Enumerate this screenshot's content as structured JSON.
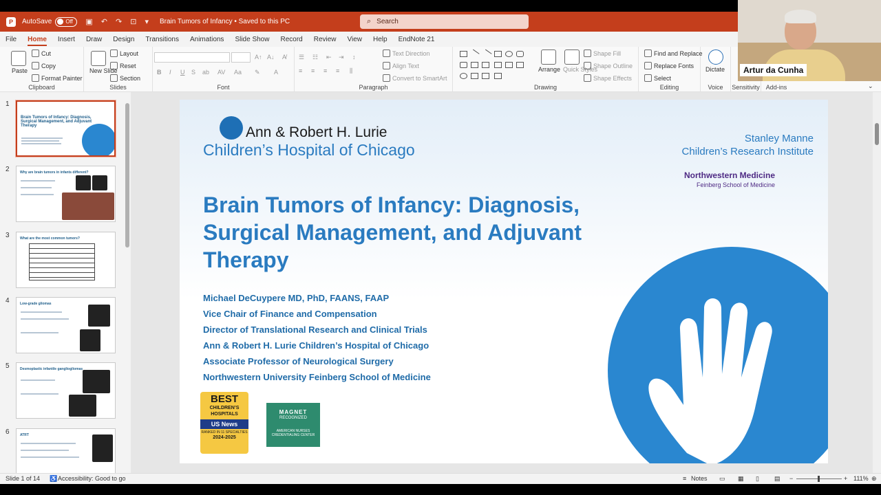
{
  "titlebar": {
    "autosave_label": "AutoSave",
    "autosave_state": "Off",
    "doc_title": "Brain Tumors of Infancy • Saved to this PC",
    "search_placeholder": "Search"
  },
  "tabs": [
    "File",
    "Home",
    "Insert",
    "Draw",
    "Design",
    "Transitions",
    "Animations",
    "Slide Show",
    "Record",
    "Review",
    "View",
    "Help",
    "EndNote 21"
  ],
  "active_tab": "Home",
  "ribbon": {
    "clipboard": {
      "label": "Clipboard",
      "paste": "Paste",
      "cut": "Cut",
      "copy": "Copy",
      "format_painter": "Format Painter"
    },
    "slides": {
      "label": "Slides",
      "new_slide": "New Slide",
      "layout": "Layout",
      "reset": "Reset",
      "section": "Section"
    },
    "font": {
      "label": "Font"
    },
    "paragraph": {
      "label": "Paragraph",
      "text_direction": "Text Direction",
      "align_text": "Align Text",
      "convert_smartart": "Convert to SmartArt"
    },
    "drawing": {
      "label": "Drawing",
      "arrange": "Arrange",
      "quick_styles": "Quick Styles",
      "shape_fill": "Shape Fill",
      "shape_outline": "Shape Outline",
      "shape_effects": "Shape Effects"
    },
    "editing": {
      "label": "Editing",
      "find_replace": "Find and Replace",
      "replace_fonts": "Replace Fonts",
      "select": "Select"
    },
    "voice": {
      "label": "Voice",
      "dictate": "Dictate"
    },
    "sensitivity": {
      "label": "Sensitivity"
    },
    "addins": {
      "label": "Add-ins"
    }
  },
  "thumbnails": [
    {
      "num": "1",
      "title": "Brain Tumors of Infancy: Diagnosis, Surgical Management, and Adjuvant Therapy"
    },
    {
      "num": "2",
      "title": "Why are brain tumors in infants different?"
    },
    {
      "num": "3",
      "title": "What are the most common tumors?"
    },
    {
      "num": "4",
      "title": "Low-grade gliomas"
    },
    {
      "num": "5",
      "title": "Desmoplastic infantile gangliogliomas"
    },
    {
      "num": "6",
      "title": "ATRT"
    }
  ],
  "slide": {
    "logo_line1": "Ann & Robert H. Lurie",
    "logo_line2": "Children’s Hospital of Chicago",
    "institute_line1": "Stanley Manne",
    "institute_line2": "Children’s Research Institute",
    "nw_line1": "Northwestern Medicine",
    "nw_line2": "Feinberg School of Medicine",
    "title": "Brain Tumors of Infancy: Diagnosis, Surgical Management, and Adjuvant Therapy",
    "author_lines": [
      "Michael DeCuypere MD, PhD, FAANS, FAAP",
      "Vice Chair of Finance and Compensation",
      "Director of Translational Research and Clinical Trials",
      "Ann & Robert H. Lurie Children’s Hospital of Chicago",
      "Associate Professor of Neurological Surgery",
      "Northwestern University Feinberg School of Medicine"
    ],
    "badge_best": {
      "line1": "BEST",
      "line2": "CHILDREN’S HOSPITALS",
      "line3": "US News",
      "line4": "RANKED IN 11 SPECIALTIES",
      "line5": "2024-2025"
    },
    "badge_magnet": {
      "line1": "MAGNET",
      "line2": "RECOGNIZED",
      "line3": "AMERICAN NURSES CREDENTIALING CENTER"
    }
  },
  "status": {
    "slide_count": "Slide 1 of 14",
    "accessibility": "Accessibility: Good to go",
    "notes": "Notes",
    "zoom": "111%"
  },
  "webcam": {
    "name": "Artur da Cunha"
  },
  "colors": {
    "accent": "#c43e1c",
    "slide_blue": "#2a7bc0"
  }
}
